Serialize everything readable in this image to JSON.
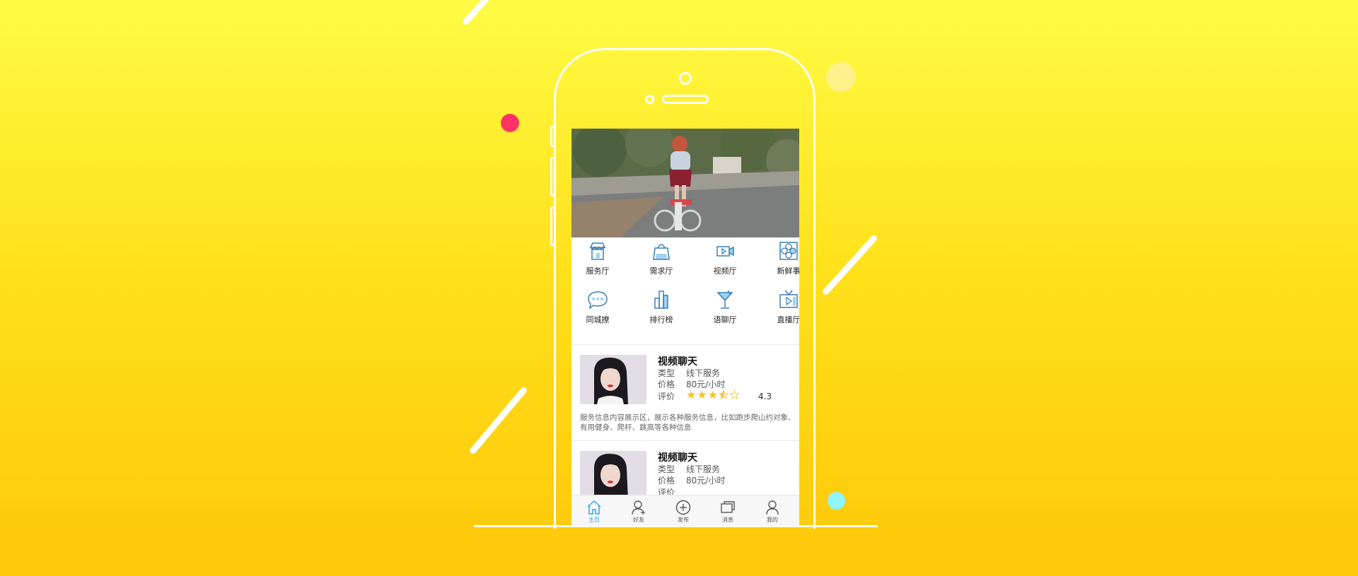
{
  "background": {
    "gradient_top": "#fffb45",
    "gradient_bottom": "#ffc709"
  },
  "decorations": {
    "dot_pink": "#ff3366",
    "dot_cyan": "#8ff5ff",
    "dot_faint": "#fff2a8"
  },
  "app": {
    "grid": [
      {
        "label": "服务厅",
        "icon": "storefront-icon"
      },
      {
        "label": "需求厅",
        "icon": "shopping-bag-icon"
      },
      {
        "label": "视频厅",
        "icon": "video-camera-icon"
      },
      {
        "label": "新鲜事",
        "icon": "flower-icon"
      },
      {
        "label": "同城撩",
        "icon": "chat-bubble-icon"
      },
      {
        "label": "排行榜",
        "icon": "ranking-bars-icon"
      },
      {
        "label": "语聊厅",
        "icon": "cocktail-glass-icon"
      },
      {
        "label": "直播厅",
        "icon": "tv-icon"
      }
    ],
    "cards": [
      {
        "title": "视频聊天",
        "type_label": "类型",
        "type_value": "线下服务",
        "price_label": "价格",
        "price_value": "80元/小时",
        "rating_label": "评价",
        "rating": 3.5,
        "rating_max": 5,
        "score": "4.3",
        "description": "服务信息内容展示区，展示各种服务信息，比如跑步爬山约对象、有用健身、爬杆、跳高等各种信息"
      },
      {
        "title": "视频聊天",
        "type_label": "类型",
        "type_value": "线下服务",
        "price_label": "价格",
        "price_value": "80元/小时",
        "rating_label": "评价"
      }
    ],
    "tabbar": [
      {
        "label": "主页",
        "icon": "home-icon",
        "active": true
      },
      {
        "label": "好友",
        "icon": "add-friend-icon",
        "active": false
      },
      {
        "label": "发布",
        "icon": "plus-circle-icon",
        "active": false
      },
      {
        "label": "消息",
        "icon": "message-icon",
        "active": false
      },
      {
        "label": "我的",
        "icon": "user-icon",
        "active": false
      }
    ],
    "accent_color": "#2aa7e6",
    "star_color": "#f5c12d"
  }
}
